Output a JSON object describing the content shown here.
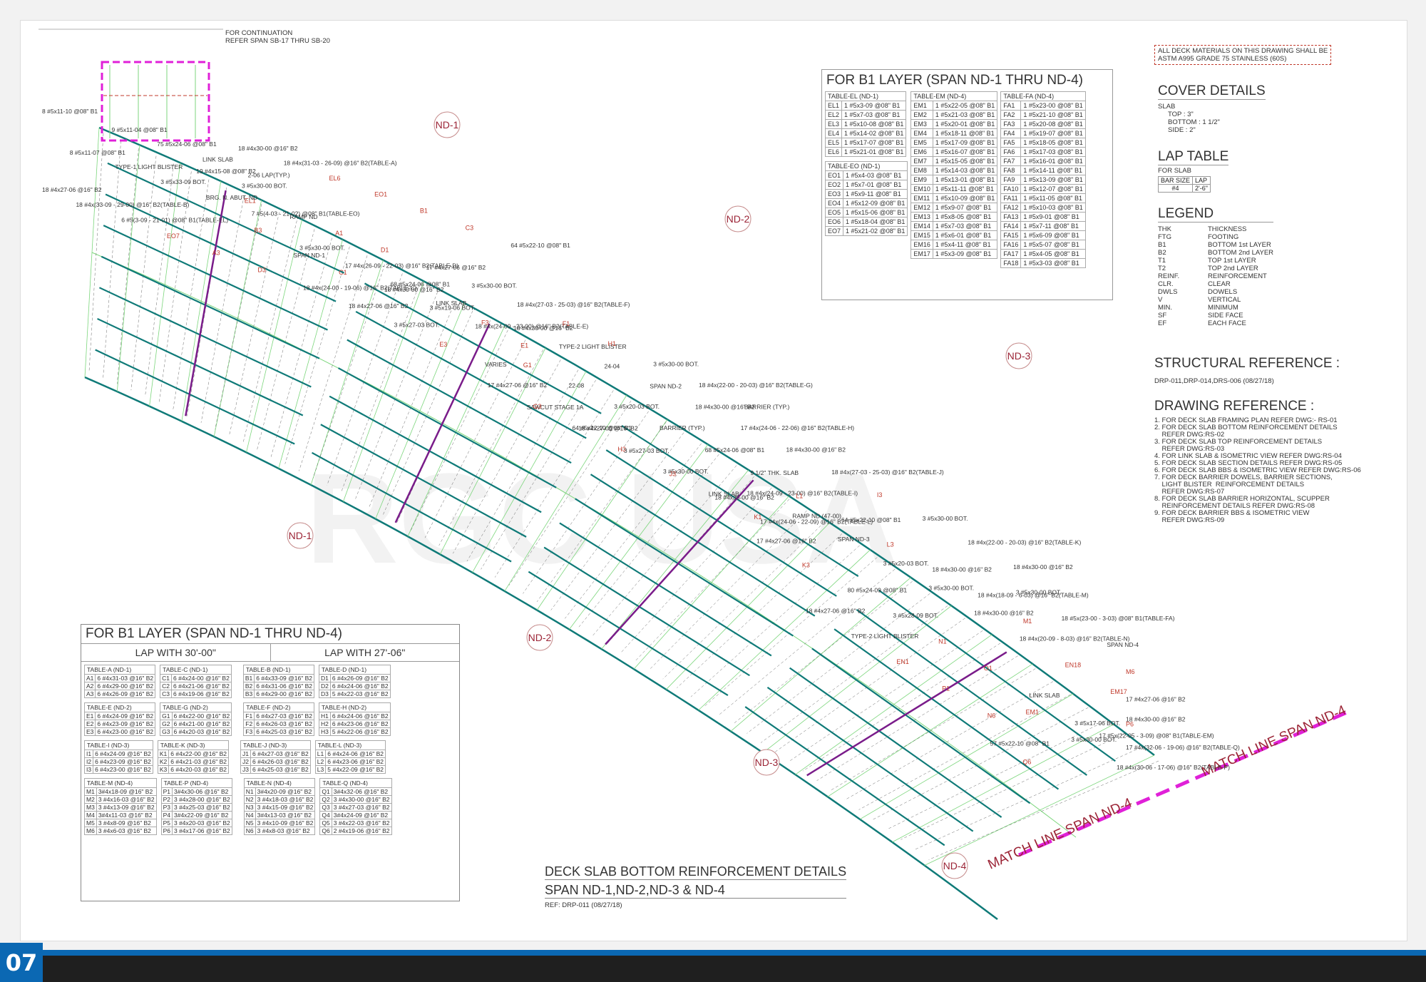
{
  "page_number": "07",
  "watermark": "RGC USA",
  "notes": {
    "continuation": [
      "FOR CONTINUATION",
      "REFER SPAN SB-17 THRU SB-20"
    ],
    "material_note": [
      "ALL DECK MATERIALS ON THIS DRAWING SHALL BE",
      "ASTM A995 GRADE 75 STAINLESS (60S)"
    ]
  },
  "span_tags": [
    "ND-1",
    "ND-2",
    "ND-3",
    "ND-1",
    "ND-2",
    "ND-3",
    "ND-4"
  ],
  "plan_labels": [
    "8 #5x11-10 @08\" B1",
    "8 #5x11-07 @08\" B1",
    "9 #5x11-04 @08\" B1",
    "19 #4x15-08 @08\" B2",
    "18 #4x30-00 @16\" B2",
    "18 #4x27-06 @16\" B2",
    "TYPE-1 LIGHT BLISTER",
    "75 #5x24-06 @08\" B1",
    "3 #5x30-00 BOT.",
    "18 #4x(31-03 - 26-09) @16\" B2(TABLE-A)",
    "18 #4x(33-09 - 29-00) @16\" B2(TABLE-B)",
    "3 #5x33-09 BOT.",
    "LINK SLAB",
    "EL1",
    "EL6",
    "6 #5(3-09 - 21-01) @08\" B1(TABLE-EL)",
    "BRG. N. ABUT. ND",
    "2-06 LAP(TYP.)",
    "RAMP ND",
    "EO1",
    "EO7",
    "7 #5(4-03 - 21-02) @08\" B1(TABLE-EO)",
    "SPAN ND-1",
    "A1",
    "B1",
    "A3",
    "B3",
    "C1",
    "D1",
    "C3",
    "D3",
    "3 #5x30-00 BOT.",
    "18 #4x30-00 @16\" B2",
    "17 #4x27-06 @16\" B2",
    "64 #5x22-10 @08\" B1",
    "18 #4x(24-00 - 19-06) @16\" B2(TABLE-C)",
    "17 #4x(26-09 - 22-03) @16\" B2(TABLE-D)",
    "3 #5x19-06 BOT.",
    "3 #5x30-00 BOT.",
    "18 #4x30-00 @16\" B2",
    "18 #4x27-06 @16\" B2",
    "68 #5x24-06 @08\" B1",
    "18 #4x(24-09 - 23-00) @16\" B2(TABLE-E)",
    "18 #4x(27-03 - 25-03) @16\" B2(TABLE-F)",
    "TYPE-2 LIGHT BLISTER",
    "3 #5x27-03 BOT.",
    "LINK SLAB",
    "E1",
    "F1",
    "24-04",
    "E3",
    "F3",
    "G1",
    "H1",
    "SPAN ND-2",
    "VARIES",
    "SAWCUT STAGE 1A",
    "22-08",
    "3 #5x30-00 BOT.",
    "18 #4x30-00 @16\" B2",
    "17 #4x27-06 @16\" B2",
    "64 #5x22-10 @08\" B1",
    "3 #5x20-03 BOT.",
    "18 #4x(22-00 - 20-03) @16\" B2(TABLE-G)",
    "17 #4x(24-06 - 22-06) @16\" B2(TABLE-H)",
    "G3",
    "H3",
    "BARRIER (TYP.)",
    "BARRIER (TYP.)",
    "18 #4x30-00 @16\" B2",
    "18 #4x27-06 @16\" B2",
    "3 #5x30-00 BOT.",
    "68 #5x24-06 @08\" B1",
    "18 #4x(24-09 - 23-00) @16\" B2(TABLE-I)",
    "18 #4x(27-03 - 25-03) @16\" B2(TABLE-J)",
    "3 #5x27-03 BOT.",
    "LINK SLAB",
    "9 1/2\" THK. SLAB",
    "RAMP ND (47-00)",
    "I3",
    "J3",
    "K1",
    "L1",
    "SPAN ND-3",
    "3 #5x30-00 BOT.",
    "18 #4x30-00 @16\" B2",
    "17 #4x27-06 @16\" B2",
    "64 #5x22-10 @08\" B1",
    "3 #5x20-03 BOT.",
    "18 #4x(22-00 - 20-03) @16\" B2(TABLE-K)",
    "17 #4x(24-06 - 22-09) @16\" B2(TABLE-L)",
    "K3",
    "L3",
    "3 #5x30-00 BOT.",
    "18 #4x30-00 @16\" B2",
    "18 #4x27-06 @16\" B2",
    "80 #5x24-09 @08\" B1",
    "18 #4x30-00 @16\" B2",
    "18 #4x30-00 @16\" B2",
    "3 #5x30-00 BOT.",
    "TYPE-2 LIGHT BLISTER",
    "3 #5x28-09 BOT.",
    "18 #4x(18-09 - 6-03) @16\" B2(TABLE-M)",
    "18 #4x(20-09 - 8-03) @16\" B2(TABLE-N)",
    "18 #5x(23-00 - 3-03) @08\" B1(TABLE-FA)",
    "EN1",
    "N1",
    "M1",
    "EN18",
    "SPAN ND-4",
    "P1",
    "O1",
    "EM1",
    "EM17",
    "M6",
    "N6",
    "LINK SLAB",
    "3 #5x30-00 BOT.",
    "18 #4x30-00 @16\" B2",
    "17 #4x27-06 @16\" B2",
    "57 #5x22-10 @08\" B1",
    "3 #5x17-06 BOT.",
    "18 #4x(30-06 - 17-06) @16\" B2(TABLE-P)",
    "17 #4x(32-06 - 19-06) @16\" B2(TABLE-Q)",
    "P6",
    "Q6",
    "17 #5x(22-05 - 3-09) @08\" B1(TABLE-EM)"
  ],
  "match_lines": [
    "MATCH LINE SPAN ND-4",
    "MATCH LINE SPAN ND-4"
  ],
  "b1_tables": {
    "title": "FOR B1 LAYER (SPAN ND-1 THRU ND-4)",
    "col1": [
      {
        "title": "TABLE-EL (ND-1)",
        "rows": [
          [
            "EL1",
            "1 #5x3-09 @08\" B1"
          ],
          [
            "EL2",
            "1 #5x7-03 @08\" B1"
          ],
          [
            "EL3",
            "1 #5x10-08 @08\" B1"
          ],
          [
            "EL4",
            "1 #5x14-02 @08\" B1"
          ],
          [
            "EL5",
            "1 #5x17-07 @08\" B1"
          ],
          [
            "EL6",
            "1 #5x21-01 @08\" B1"
          ]
        ]
      },
      {
        "title": "TABLE-EO (ND-1)",
        "rows": [
          [
            "EO1",
            "1 #5x4-03 @08\" B1"
          ],
          [
            "EO2",
            "1 #5x7-01 @08\" B1"
          ],
          [
            "EO3",
            "1 #5x9-11 @08\" B1"
          ],
          [
            "EO4",
            "1 #5x12-09 @08\" B1"
          ],
          [
            "EO5",
            "1 #5x15-06 @08\" B1"
          ],
          [
            "EO6",
            "1 #5x18-04 @08\" B1"
          ],
          [
            "EO7",
            "1 #5x21-02 @08\" B1"
          ]
        ]
      }
    ],
    "col2": {
      "title": "TABLE-EM (ND-4)",
      "rows": [
        [
          "EM1",
          "1 #5x22-05 @08\" B1"
        ],
        [
          "EM2",
          "1 #5x21-03 @08\" B1"
        ],
        [
          "EM3",
          "1 #5x20-01 @08\" B1"
        ],
        [
          "EM4",
          "1 #5x18-11 @08\" B1"
        ],
        [
          "EM5",
          "1 #5x17-09 @08\" B1"
        ],
        [
          "EM6",
          "1 #5x16-07 @08\" B1"
        ],
        [
          "EM7",
          "1 #5x15-05 @08\" B1"
        ],
        [
          "EM8",
          "1 #5x14-03 @08\" B1"
        ],
        [
          "EM9",
          "1 #5x13-01 @08\" B1"
        ],
        [
          "EM10",
          "1 #5x11-11 @08\" B1"
        ],
        [
          "EM11",
          "1 #5x10-09 @08\" B1"
        ],
        [
          "EM12",
          "1 #5x9-07 @08\" B1"
        ],
        [
          "EM13",
          "1 #5x8-05 @08\" B1"
        ],
        [
          "EM14",
          "1 #5x7-03 @08\" B1"
        ],
        [
          "EM15",
          "1 #5x6-01 @08\" B1"
        ],
        [
          "EM16",
          "1 #5x4-11 @08\" B1"
        ],
        [
          "EM17",
          "1 #5x3-09 @08\" B1"
        ]
      ]
    },
    "col3": {
      "title": "TABLE-FA (ND-4)",
      "rows": [
        [
          "FA1",
          "1 #5x23-00 @08\" B1"
        ],
        [
          "FA2",
          "1 #5x21-10 @08\" B1"
        ],
        [
          "FA3",
          "1 #5x20-08 @08\" B1"
        ],
        [
          "FA4",
          "1 #5x19-07 @08\" B1"
        ],
        [
          "FA5",
          "1 #5x18-05 @08\" B1"
        ],
        [
          "FA6",
          "1 #5x17-03 @08\" B1"
        ],
        [
          "FA7",
          "1 #5x16-01 @08\" B1"
        ],
        [
          "FA8",
          "1 #5x14-11 @08\" B1"
        ],
        [
          "FA9",
          "1 #5x13-09 @08\" B1"
        ],
        [
          "FA10",
          "1 #5x12-07 @08\" B1"
        ],
        [
          "FA11",
          "1 #5x11-05 @08\" B1"
        ],
        [
          "FA12",
          "1 #5x10-03 @08\" B1"
        ],
        [
          "FA13",
          "1 #5x9-01 @08\" B1"
        ],
        [
          "FA14",
          "1 #5x7-11 @08\" B1"
        ],
        [
          "FA15",
          "1 #5x6-09 @08\" B1"
        ],
        [
          "FA16",
          "1 #5x5-07 @08\" B1"
        ],
        [
          "FA17",
          "1 #5x4-05 @08\" B1"
        ],
        [
          "FA18",
          "1 #5x3-03 @08\" B1"
        ]
      ]
    }
  },
  "cover": {
    "title": "COVER DETAILS",
    "slab": "SLAB",
    "lines": [
      "TOP : 3\"",
      "BOTTOM : 1 1/2\"",
      "SIDE : 2\""
    ]
  },
  "lap": {
    "title": "LAP TABLE",
    "for": "FOR SLAB",
    "head": [
      "BAR SIZE",
      "LAP"
    ],
    "row": [
      "#4",
      "2'-6\""
    ]
  },
  "legend": {
    "title": "LEGEND",
    "items": [
      [
        "THK",
        "THICKNESS"
      ],
      [
        "FTG",
        "FOOTING"
      ],
      [
        "B1",
        "BOTTOM 1st LAYER"
      ],
      [
        "B2",
        "BOTTOM 2nd LAYER"
      ],
      [
        "T1",
        "TOP 1st LAYER"
      ],
      [
        "T2",
        "TOP 2nd LAYER"
      ],
      [
        "REINF.",
        "REINFORCEMENT"
      ],
      [
        "CLR.",
        "CLEAR"
      ],
      [
        "DWLS",
        "DOWELS"
      ],
      [
        "V",
        "VERTICAL"
      ],
      [
        "MIN.",
        "MINIMUM"
      ],
      [
        "SF",
        "SIDE FACE"
      ],
      [
        "EF",
        "EACH FACE"
      ]
    ]
  },
  "structural": {
    "title": "STRUCTURAL REFERENCE :",
    "text": "DRP-011,DRP-014,DRS-006 (08/27/18)"
  },
  "drawing_ref": {
    "title": "DRAWING REFERENCE :",
    "items": [
      "1. FOR DECK SLAB FRAMING PLAN REFER DWG:- RS-01",
      "2. FOR DECK SLAB BOTTOM REINFORCEMENT DETAILS",
      "    REFER DWG:RS-02",
      "3. FOR DECK SLAB TOP REINFORCEMENT DETAILS",
      "    REFER DWG:RS-03",
      "4. FOR LINK SLAB & ISOMETRIC VIEW REFER DWG:RS-04",
      "5. FOR DECK SLAB SECTION DETAILS REFER DWG:RS-05",
      "6. FOR DECK SLAB BBS & ISOMETRIC VIEW REFER DWG:RS-06",
      "7. FOR DECK BARRIER DOWELS, BARRIER SECTIONS,",
      "    LIGHT BLISTER  REINFORCEMENT DETAILS",
      "    REFER DWG:RS-07",
      "8. FOR DECK SLAB BARRIER HORIZONTAL, SCUPPER",
      "    REINFORCEMENT DETAILS REFER DWG:RS-08",
      "9. FOR DECK BARRIER BBS & ISOMETRIC VIEW",
      "    REFER DWG:RS-09"
    ]
  },
  "b2_table": {
    "title": "FOR B1 LAYER (SPAN ND-1 THRU ND-4)",
    "left_head": "LAP WITH 30'-00\"",
    "right_head": "LAP WITH 27'-06\"",
    "blocks": [
      [
        {
          "t": "TABLE-A (ND-1)",
          "r": [
            [
              "A1",
              "6 #4x31-03 @16\" B2"
            ],
            [
              "A2",
              "6 #4x29-00 @16\" B2"
            ],
            [
              "A3",
              "6 #4x26-09 @16\" B2"
            ]
          ]
        },
        {
          "t": "TABLE-C (ND-1)",
          "r": [
            [
              "C1",
              "6 #4x24-00 @16\" B2"
            ],
            [
              "C2",
              "6 #4x21-06 @16\" B2"
            ],
            [
              "C3",
              "6 #4x19-06 @16\" B2"
            ]
          ]
        },
        {
          "t": "TABLE-B (ND-1)",
          "r": [
            [
              "B1",
              "6 #4x33-09 @16\" B2"
            ],
            [
              "B2",
              "6 #4x31-06 @16\" B2"
            ],
            [
              "B3",
              "6 #4x29-00 @16\" B2"
            ]
          ]
        },
        {
          "t": "TABLE-D (ND-1)",
          "r": [
            [
              "D1",
              "6 #4x26-09 @16\" B2"
            ],
            [
              "D2",
              "6 #4x24-06 @16\" B2"
            ],
            [
              "D3",
              "5 #4x22-03 @16\" B2"
            ]
          ]
        }
      ],
      [
        {
          "t": "TABLE-E (ND-2)",
          "r": [
            [
              "E1",
              "6 #4x24-09 @16\" B2"
            ],
            [
              "E2",
              "6 #4x23-09 @16\" B2"
            ],
            [
              "E3",
              "6 #4x23-00 @16\" B2"
            ]
          ]
        },
        {
          "t": "TABLE-G (ND-2)",
          "r": [
            [
              "G1",
              "6 #4x22-00 @16\" B2"
            ],
            [
              "G2",
              "6 #4x21-00 @16\" B2"
            ],
            [
              "G3",
              "6 #4x20-03 @16\" B2"
            ]
          ]
        },
        {
          "t": "TABLE-F (ND-2)",
          "r": [
            [
              "F1",
              "6 #4x27-03 @16\" B2"
            ],
            [
              "F2",
              "6 #4x26-03 @16\" B2"
            ],
            [
              "F3",
              "6 #4x25-03 @16\" B2"
            ]
          ]
        },
        {
          "t": "TABLE-H (ND-2)",
          "r": [
            [
              "H1",
              "6 #4x24-06 @16\" B2"
            ],
            [
              "H2",
              "6 #4x23-06 @16\" B2"
            ],
            [
              "H3",
              "5 #4x22-06 @16\" B2"
            ]
          ]
        }
      ],
      [
        {
          "t": "TABLE-I (ND-3)",
          "r": [
            [
              "I1",
              "6 #4x24-09 @16\" B2"
            ],
            [
              "I2",
              "6 #4x23-09 @16\" B2"
            ],
            [
              "I3",
              "6 #4x23-00 @16\" B2"
            ]
          ]
        },
        {
          "t": "TABLE-K (ND-3)",
          "r": [
            [
              "K1",
              "6 #4x22-00 @16\" B2"
            ],
            [
              "K2",
              "6 #4x21-03 @16\" B2"
            ],
            [
              "K3",
              "6 #4x20-03 @16\" B2"
            ]
          ]
        },
        {
          "t": "TABLE-J (ND-3)",
          "r": [
            [
              "J1",
              "6 #4x27-03 @16\" B2"
            ],
            [
              "J2",
              "6 #4x26-03 @16\" B2"
            ],
            [
              "J3",
              "6 #4x25-03 @16\" B2"
            ]
          ]
        },
        {
          "t": "TABLE-L (ND-3)",
          "r": [
            [
              "L1",
              "6 #4x24-06 @16\" B2"
            ],
            [
              "L2",
              "6 #4x23-06 @16\" B2"
            ],
            [
              "L3",
              "5 #4x22-09 @16\" B2"
            ]
          ]
        }
      ],
      [
        {
          "t": "TABLE-M (ND-4)",
          "r": [
            [
              "M1",
              "3#4x18-09 @16\" B2"
            ],
            [
              "M2",
              "3 #4x16-03 @16\" B2"
            ],
            [
              "M3",
              "3 #4x13-09 @16\" B2"
            ],
            [
              "M4",
              "3#4x11-03 @16\" B2"
            ],
            [
              "M5",
              "3 #4x8-09 @16\" B2"
            ],
            [
              "M6",
              "3 #4x6-03 @16\" B2"
            ]
          ]
        },
        {
          "t": "TABLE-P (ND-4)",
          "r": [
            [
              "P1",
              "3#4x30-06 @16\" B2"
            ],
            [
              "P2",
              "3 #4x28-00 @16\" B2"
            ],
            [
              "P3",
              "3 #4x25-03 @16\" B2"
            ],
            [
              "P4",
              "3#4x22-09 @16\" B2"
            ],
            [
              "P5",
              "3 #4x20-03 @16\" B2"
            ],
            [
              "P6",
              "3 #4x17-06 @16\" B2"
            ]
          ]
        },
        {
          "t": "TABLE-N (ND-4)",
          "r": [
            [
              "N1",
              "3#4x20-09 @16\" B2"
            ],
            [
              "N2",
              "3 #4x18-03 @16\" B2"
            ],
            [
              "N3",
              "3 #4x15-09 @16\" B2"
            ],
            [
              "N4",
              "3#4x13-03 @16\" B2"
            ],
            [
              "N5",
              "3 #4x10-09 @16\" B2"
            ],
            [
              "N6",
              "3 #4x8-03 @16\" B2"
            ]
          ]
        },
        {
          "t": "TABLE-Q (ND-4)",
          "r": [
            [
              "Q1",
              "3#4x32-06 @16\" B2"
            ],
            [
              "Q2",
              "3 #4x30-00 @16\" B2"
            ],
            [
              "Q3",
              "3 #4x27-03 @16\" B2"
            ],
            [
              "Q4",
              "3#4x24-09 @16\" B2"
            ],
            [
              "Q5",
              "3 #4x22-03 @16\" B2"
            ],
            [
              "Q6",
              "2 #4x19-06 @16\" B2"
            ]
          ]
        }
      ]
    ]
  },
  "title_block": {
    "title": "DECK SLAB BOTTOM REINFORCEMENT DETAILS",
    "sub": "SPAN ND-1,ND-2,ND-3 & ND-4",
    "ref": "REF: DRP-011 (08/27/18)"
  },
  "colors": {
    "rebar": "#0f7a78",
    "purple": "#7a1c8a",
    "magenta": "#e020d8",
    "red": "#c0392b",
    "green": "#7cd67c",
    "tag_red": "#9b2335",
    "footer_blue": "#0b68b3"
  }
}
